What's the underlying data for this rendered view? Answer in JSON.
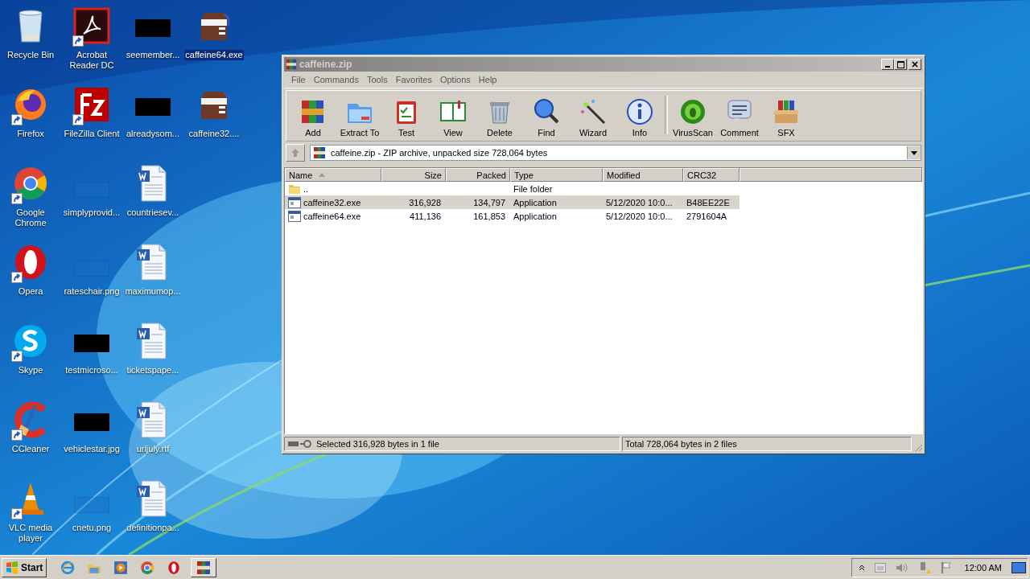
{
  "desktop": {
    "icons": [
      {
        "label": "Recycle Bin",
        "kind": "recycle",
        "shortcut": false,
        "selected": false
      },
      {
        "label": "Firefox",
        "kind": "firefox",
        "shortcut": true,
        "selected": false
      },
      {
        "label": "Google Chrome",
        "kind": "chrome",
        "shortcut": true,
        "selected": false
      },
      {
        "label": "Opera",
        "kind": "opera",
        "shortcut": true,
        "selected": false
      },
      {
        "label": "Skype",
        "kind": "skype",
        "shortcut": true,
        "selected": false
      },
      {
        "label": "CCleaner",
        "kind": "ccleaner",
        "shortcut": true,
        "selected": false
      },
      {
        "label": "VLC media player",
        "kind": "vlc",
        "shortcut": true,
        "selected": false
      },
      {
        "label": "Acrobat Reader DC",
        "kind": "acrobat",
        "shortcut": true,
        "selected": false
      },
      {
        "label": "FileZilla Client",
        "kind": "filezilla",
        "shortcut": true,
        "selected": false
      },
      {
        "label": "simplyprovid...",
        "kind": "blank",
        "shortcut": false,
        "selected": false
      },
      {
        "label": "rateschair.png",
        "kind": "blank",
        "shortcut": false,
        "selected": false
      },
      {
        "label": "testmicroso...",
        "kind": "redacted",
        "shortcut": false,
        "selected": false
      },
      {
        "label": "vehiclestar.jpg",
        "kind": "redacted",
        "shortcut": false,
        "selected": false
      },
      {
        "label": "cnetu.png",
        "kind": "blank",
        "shortcut": false,
        "selected": false
      },
      {
        "label": "seemember...",
        "kind": "redacted",
        "shortcut": false,
        "selected": false
      },
      {
        "label": "alreadysom...",
        "kind": "redacted",
        "shortcut": false,
        "selected": false
      },
      {
        "label": "countriesev...",
        "kind": "word",
        "shortcut": false,
        "selected": false
      },
      {
        "label": "maximumop...",
        "kind": "word",
        "shortcut": false,
        "selected": false
      },
      {
        "label": "ticketspape...",
        "kind": "word",
        "shortcut": false,
        "selected": false
      },
      {
        "label": "urljuly.rtf",
        "kind": "word",
        "shortcut": false,
        "selected": false
      },
      {
        "label": "definitionpa...",
        "kind": "word",
        "shortcut": false,
        "selected": false
      },
      {
        "label": "caffeine64.exe",
        "kind": "coffee",
        "shortcut": false,
        "selected": true
      },
      {
        "label": "caffeine32....",
        "kind": "coffee",
        "shortcut": false,
        "selected": false
      }
    ]
  },
  "window": {
    "title": "caffeine.zip",
    "active": false,
    "menu": [
      "File",
      "Commands",
      "Tools",
      "Favorites",
      "Options",
      "Help"
    ],
    "toolbar": [
      [
        {
          "label": "Add",
          "kind": "add"
        },
        {
          "label": "Extract To",
          "kind": "extract"
        },
        {
          "label": "Test",
          "kind": "test"
        },
        {
          "label": "View",
          "kind": "view"
        },
        {
          "label": "Delete",
          "kind": "delete"
        },
        {
          "label": "Find",
          "kind": "find"
        },
        {
          "label": "Wizard",
          "kind": "wizard"
        },
        {
          "label": "Info",
          "kind": "info"
        }
      ],
      [
        {
          "label": "VirusScan",
          "kind": "virus"
        },
        {
          "label": "Comment",
          "kind": "comment"
        },
        {
          "label": "SFX",
          "kind": "sfx"
        }
      ]
    ],
    "address": "caffeine.zip - ZIP archive, unpacked size 728,064 bytes",
    "table": {
      "columns": [
        {
          "label": "Name",
          "kind": "text",
          "sorted": true
        },
        {
          "label": "Size",
          "kind": "number",
          "sorted": false
        },
        {
          "label": "Packed",
          "kind": "number",
          "sorted": false
        },
        {
          "label": "Type",
          "kind": "text",
          "sorted": false
        },
        {
          "label": "Modified",
          "kind": "text",
          "sorted": false
        },
        {
          "label": "CRC32",
          "kind": "text",
          "sorted": false
        }
      ],
      "rows": [
        {
          "kind": "folder",
          "selected": false,
          "cells": [
            "..",
            "",
            "",
            "File folder",
            "",
            ""
          ]
        },
        {
          "kind": "exe",
          "selected": true,
          "cells": [
            "caffeine32.exe",
            "316,928",
            "134,797",
            "Application",
            "5/12/2020 10:0...",
            "B48EE22E"
          ]
        },
        {
          "kind": "exe",
          "selected": false,
          "cells": [
            "caffeine64.exe",
            "411,136",
            "161,853",
            "Application",
            "5/12/2020 10:0...",
            "2791604A"
          ]
        }
      ]
    },
    "status_bar": {
      "selection": "Selected 316,928 bytes in 1 file",
      "total": "Total 728,064 bytes in 2 files"
    }
  },
  "taskbar": {
    "start": "Start",
    "items": [
      {
        "kind": "ie",
        "active": false
      },
      {
        "kind": "explorer",
        "active": false
      },
      {
        "kind": "media",
        "active": false
      },
      {
        "kind": "chrome",
        "active": false
      },
      {
        "kind": "opera",
        "active": false
      },
      {
        "kind": "winrar",
        "active": true
      }
    ],
    "clock": "12:00 AM"
  }
}
